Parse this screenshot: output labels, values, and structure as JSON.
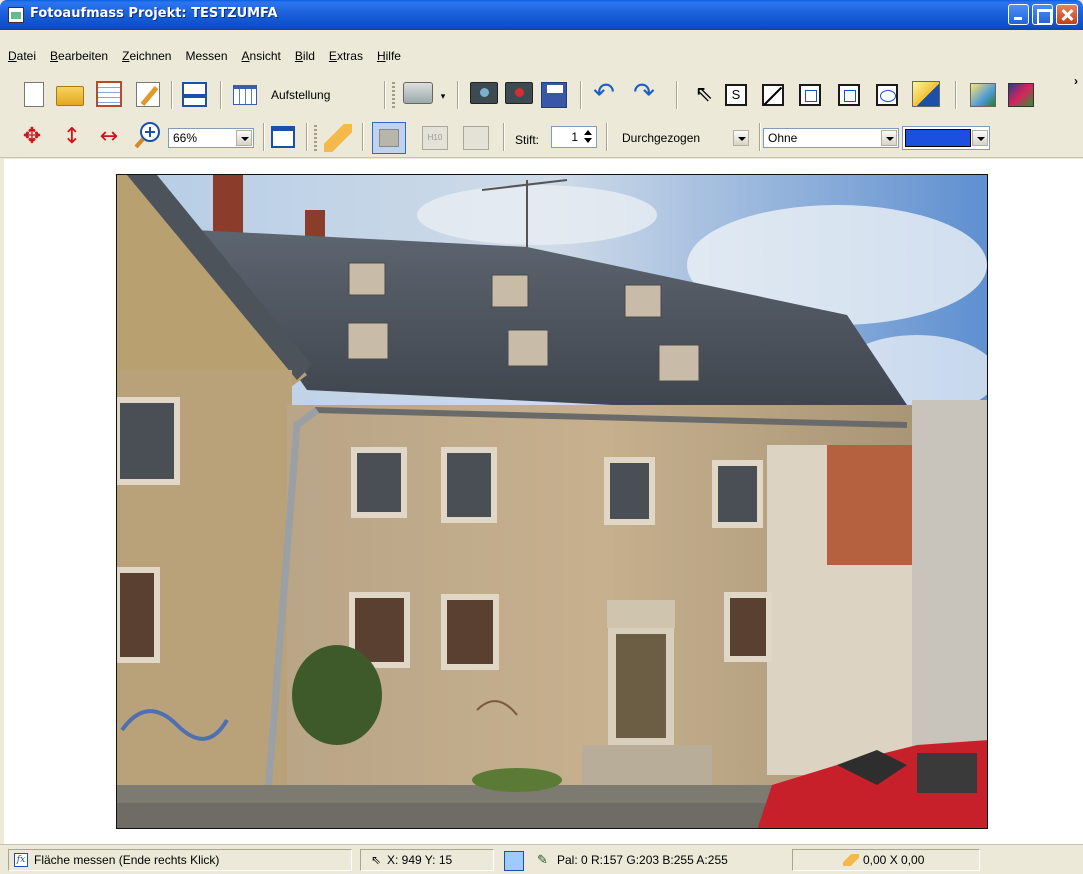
{
  "window": {
    "title": "Fotoaufmass  Projekt: TESTZUMFA"
  },
  "menu": [
    {
      "pre": "",
      "u": "D",
      "post": "atei"
    },
    {
      "pre": "",
      "u": "B",
      "post": "earbeiten"
    },
    {
      "pre": "",
      "u": "Z",
      "post": "eichnen"
    },
    {
      "pre": "Messen",
      "u": "",
      "post": ""
    },
    {
      "pre": "",
      "u": "A",
      "post": "nsicht"
    },
    {
      "pre": "",
      "u": "B",
      "post": "ild"
    },
    {
      "pre": "",
      "u": "E",
      "post": "xtras"
    },
    {
      "pre": "",
      "u": "H",
      "post": "ilfe"
    }
  ],
  "toolbar": {
    "aufstellung_label": "Aufstellung",
    "zoom_value": "66%",
    "pen_label": "Stift:",
    "pen_width": "1",
    "line_style": "Durchgezogen",
    "fill_style": "Ohne",
    "pen_color": "#1a4fe0"
  },
  "status": {
    "hint": "Fläche messen (Ende rechts Klick)",
    "coords": "X: 949 Y:  15",
    "palette": "Pal:  0 R:157 G:203 B:255 A:255",
    "palette_color": "#9dcbff",
    "area": "0,00 X 0,00"
  }
}
